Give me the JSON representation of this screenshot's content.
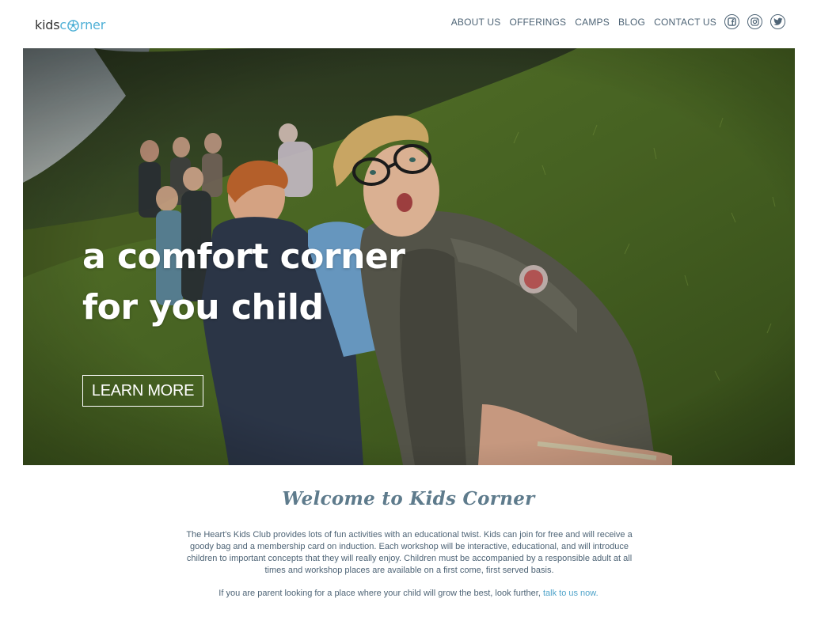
{
  "brand": {
    "logo_kids": "kids",
    "logo_c": "c",
    "logo_rner": "rner",
    "accent_color": "#4fb0d6"
  },
  "nav": {
    "items": [
      {
        "label": "ABOUT US"
      },
      {
        "label": "OFFERINGS"
      },
      {
        "label": "CAMPS"
      },
      {
        "label": "BLOG"
      },
      {
        "label": "CONTACT US"
      }
    ],
    "social": [
      "facebook-icon",
      "instagram-icon",
      "twitter-icon"
    ]
  },
  "hero": {
    "title_line1": "a comfort corner",
    "title_line2": "for you child",
    "button_label": "LEARN MORE",
    "image": "children-playing-tug-of-war-photo"
  },
  "welcome": {
    "heading": "Welcome to Kids Corner",
    "body": "The Heart's Kids Club provides lots of fun activities with an educational twist. Kids can join for free and will receive a goody bag and a membership card on induction. Each workshop will be interactive, educational, and will introduce children to important concepts that they will really enjoy. Children must be accompanied by a responsible adult at all times and workshop places are available on a first come, first served basis.",
    "cta_text": "If you are parent looking for a place where your child will grow the best, look further, ",
    "cta_link": "talk to us now."
  }
}
